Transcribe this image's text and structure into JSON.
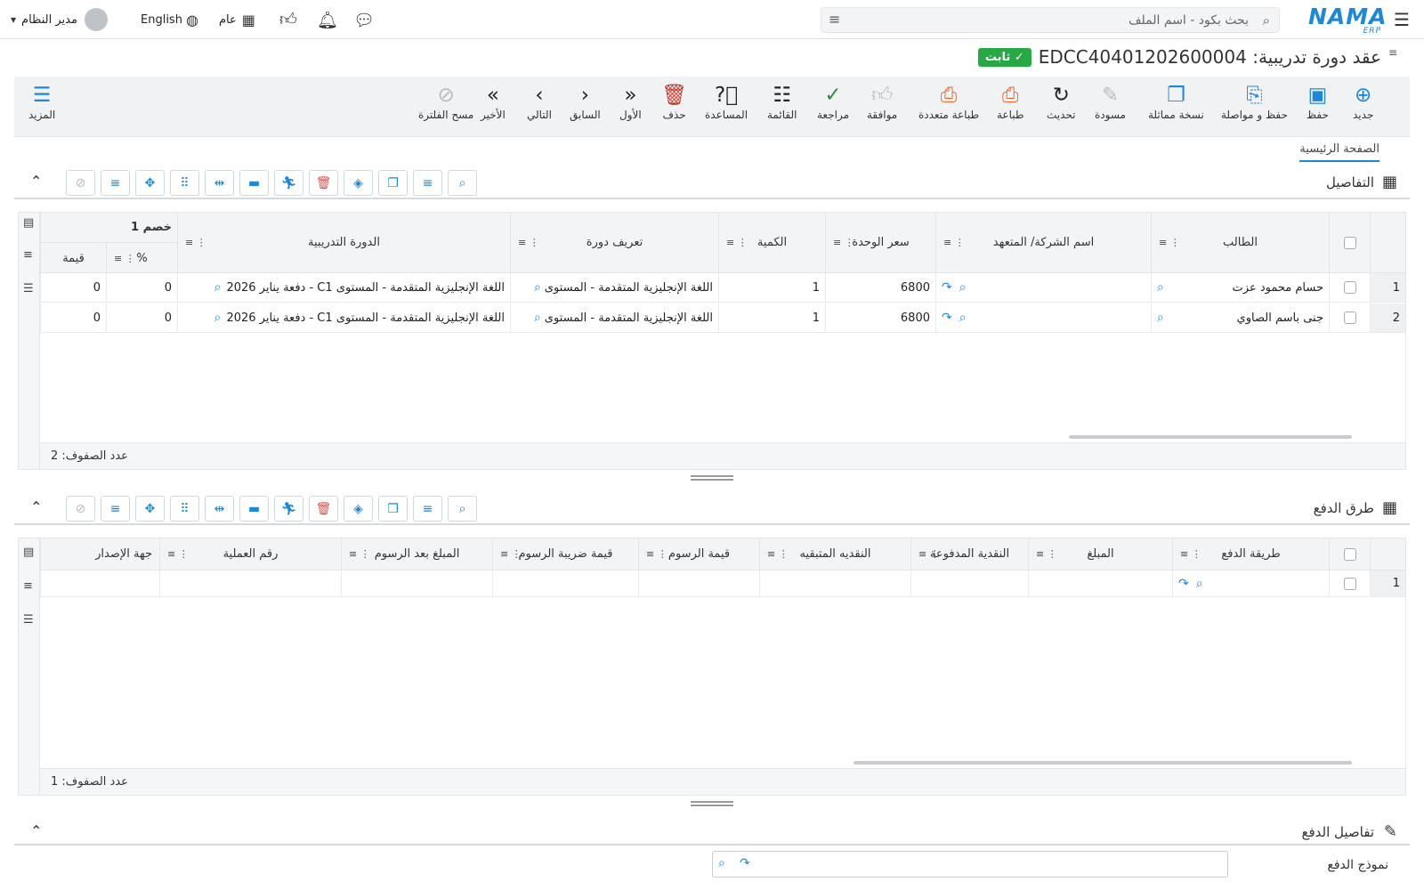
{
  "topbar": {
    "search_placeholder": "بحث بكود - اسم الملف",
    "user_name": "مدير النظام",
    "language": "English",
    "branch": "عام",
    "logo_text": "NAMA",
    "logo_sub": "ERP"
  },
  "page": {
    "title": "عقد دورة تدريبية: EDCC40401202600004",
    "status_badge": "ثابت"
  },
  "toolbar": {
    "new": "جديد",
    "save": "حفظ",
    "save_continue": "حفظ و مواصلة",
    "duplicate": "نسخة مماثلة",
    "draft": "مسودة",
    "refresh": "تحديث",
    "print": "طباعة",
    "multi_print": "طباعة متعددة",
    "approve": "موافقة",
    "review": "مراجعة",
    "list": "القائمة",
    "help": "المساعدة",
    "delete": "حذف",
    "first": "الأول",
    "previous": "السابق",
    "next": "التالي",
    "last": "الأخير",
    "clear_filter": "مسح الفلترة",
    "more": "المزيد"
  },
  "tabs": {
    "main": "الصفحة الرئيسية"
  },
  "details": {
    "title": "التفاصيل",
    "group_header": "خصم 1",
    "columns": {
      "student": "الطالب",
      "company": "اسم الشركة/ المتعهد",
      "unit_price": "سعر الوحدة",
      "quantity": "الكمية",
      "course_def": "تعريف دورة",
      "course": "الدورة التدريبية",
      "percent": "%",
      "value": "قيمة"
    },
    "rows": [
      {
        "num": "1",
        "student": "حسام محمود عزت",
        "unit_price": "6800",
        "quantity": "1",
        "course_def": "اللغة الإنجليزية المتقدمة - المستوى",
        "course": "اللغة الإنجليزية المتقدمة - المستوى C1 - دفعة يناير 2026",
        "percent": "0",
        "value": "0"
      },
      {
        "num": "2",
        "student": "جنى باسم الصاوي",
        "unit_price": "6800",
        "quantity": "1",
        "course_def": "اللغة الإنجليزية المتقدمة - المستوى",
        "course": "اللغة الإنجليزية المتقدمة - المستوى C1 - دفعة يناير 2026",
        "percent": "0",
        "value": "0"
      }
    ],
    "row_count": "عدد الصفوف: 2"
  },
  "payments": {
    "title": "طرق الدفع",
    "columns": {
      "method": "طريقة الدفع",
      "amount": "المبلغ",
      "cash_paid": "النقدية المدفوعة",
      "cash_remaining": "النقديه المتبقيه",
      "fees": "قيمة الرسوم",
      "fees_tax": "قيمة ضريبة الرسوم",
      "after_fees": "المبلغ بعد الرسوم",
      "op_number": "رقم العملية",
      "issuer": "جهة الإصدار"
    },
    "rows": [
      {
        "num": "1"
      }
    ],
    "row_count": "عدد الصفوف: 1"
  },
  "payment_details": {
    "title": "تفاصيل الدفع",
    "form_label": "نموذج الدفع"
  }
}
